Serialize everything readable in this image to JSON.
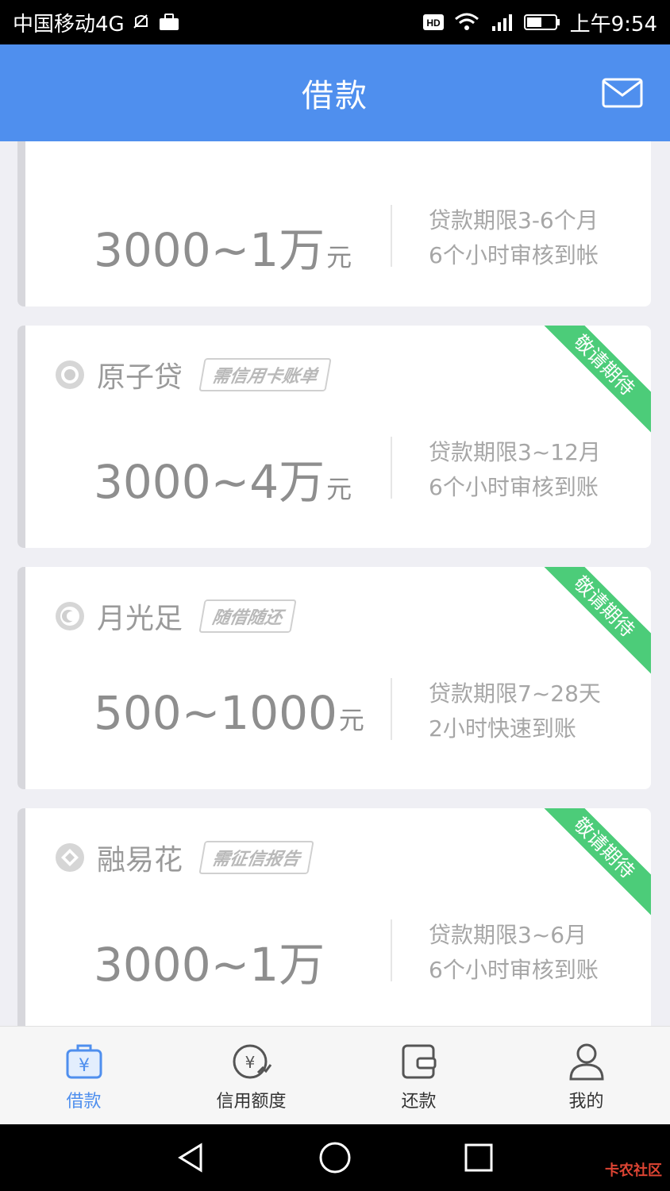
{
  "status_bar": {
    "carrier": "中国移动4G",
    "time": "上午9:54",
    "icons": [
      "notification-muted-icon",
      "briefcase-icon",
      "hd-icon",
      "wifi-icon",
      "signal-icon",
      "battery-icon"
    ]
  },
  "header": {
    "title": "借款",
    "mail_icon": "mail-icon",
    "color": "#4f8fee"
  },
  "cards": [
    {
      "name": "",
      "tag": "",
      "amount": "3000~1万",
      "unit": "元",
      "term": "贷款期限3-6个月",
      "review": "6个小时审核到帐",
      "ribbon": ""
    },
    {
      "name": "原子贷",
      "tag": "需信用卡账单",
      "amount": "3000~4万",
      "unit": "元",
      "term": "贷款期限3~12月",
      "review": "6个小时审核到账",
      "ribbon": "敬请期待"
    },
    {
      "name": "月光足",
      "tag": "随借随还",
      "amount": "500~1000",
      "unit": "元",
      "term": "贷款期限7~28天",
      "review": "2小时快速到账",
      "ribbon": "敬请期待"
    },
    {
      "name": "融易花",
      "tag": "需征信报告",
      "amount": "3000~1万",
      "unit": "",
      "term": "贷款期限3~6月",
      "review": "6个小时审核到账",
      "ribbon": "敬请期待"
    }
  ],
  "tabs": [
    {
      "label": "借款",
      "icon": "loan-bag-icon",
      "active": true
    },
    {
      "label": "信用额度",
      "icon": "credit-limit-icon",
      "active": false
    },
    {
      "label": "还款",
      "icon": "wallet-icon",
      "active": false
    },
    {
      "label": "我的",
      "icon": "user-icon",
      "active": false
    }
  ],
  "nav": {
    "icons": [
      "back-icon",
      "home-icon",
      "recents-icon"
    ]
  },
  "watermark": "卡农社区",
  "colors": {
    "accent": "#4f8fee",
    "ribbon": "#4ccc79",
    "text_gray": "#8e8e8e"
  }
}
